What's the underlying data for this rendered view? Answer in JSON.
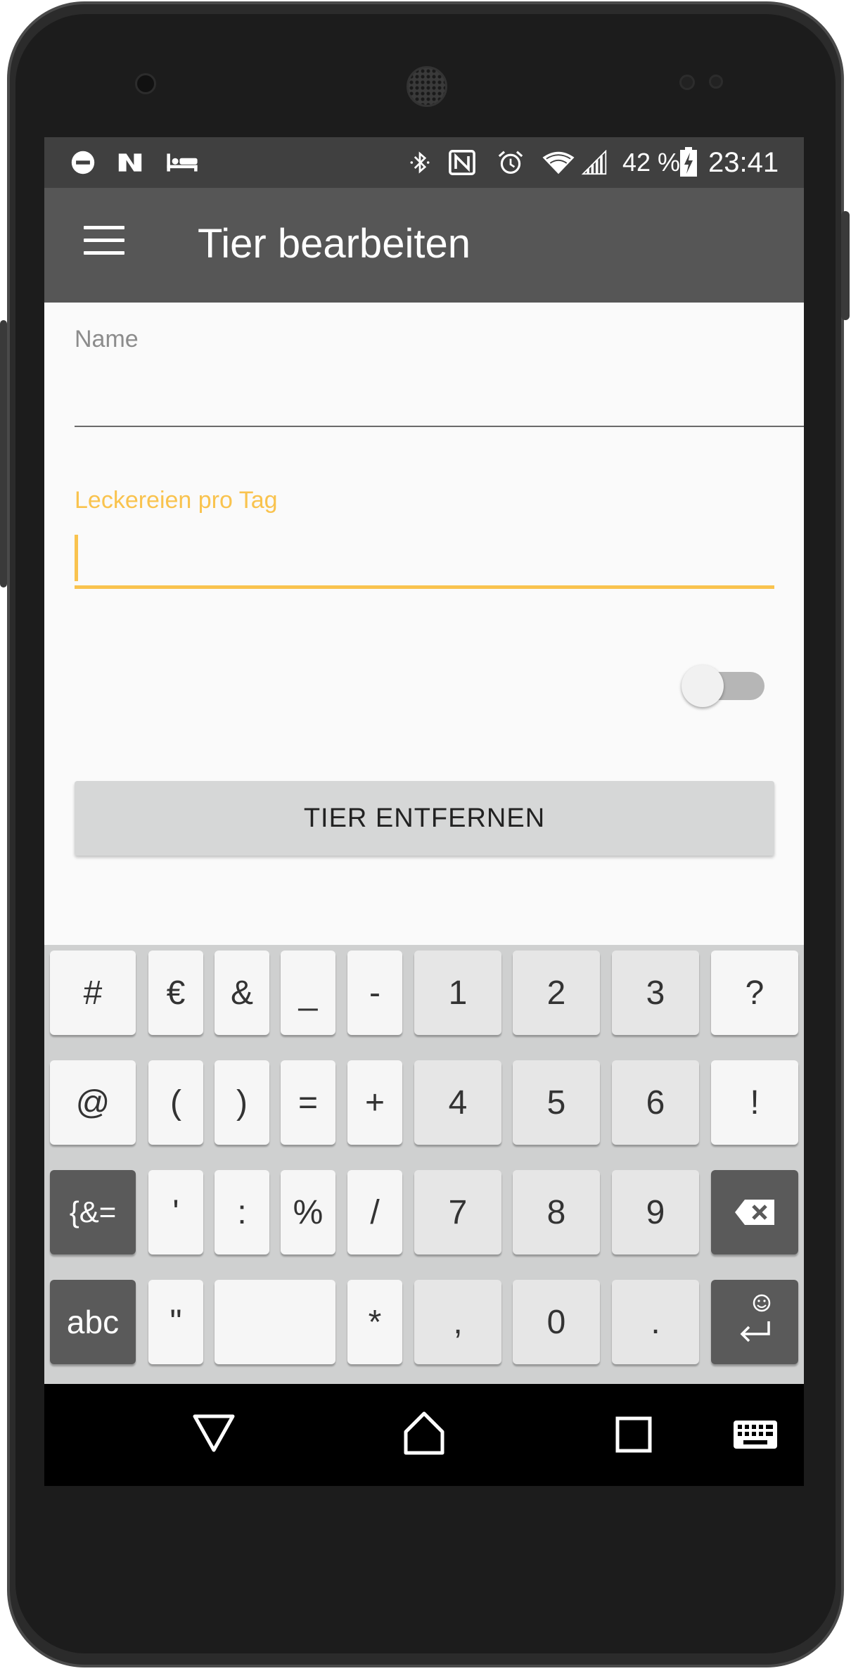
{
  "status_bar": {
    "battery_percent": "42 %",
    "time": "23:41",
    "left_icons": [
      "do-not-disturb-icon",
      "n-app-icon",
      "sleep-bed-icon"
    ],
    "right_icons": [
      "bluetooth-icon",
      "nfc-icon",
      "alarm-icon",
      "wifi-icon",
      "cell-signal-icon",
      "battery-charging-icon"
    ]
  },
  "app_bar": {
    "title": "Tier bearbeiten",
    "menu_icon": "hamburger-menu-icon"
  },
  "form": {
    "name_label": "Name",
    "name_value": "",
    "treats_label": "Leckereien pro Tag",
    "treats_value": "",
    "switch_on": false,
    "remove_button": "TIER ENTFERNEN"
  },
  "keyboard": {
    "rows": [
      [
        "#",
        "€",
        "&",
        "_",
        "-",
        "1",
        "2",
        "3",
        "?"
      ],
      [
        "@",
        "(",
        ")",
        "=",
        "+",
        "4",
        "5",
        "6",
        "!"
      ],
      [
        "{&=",
        "'",
        ":",
        "%",
        "/",
        "7",
        "8",
        "9",
        "backspace"
      ],
      [
        "abc",
        "\"",
        "space",
        "*",
        ",",
        "0",
        ".",
        "enter"
      ]
    ]
  },
  "nav_bar": {
    "icons": [
      "back-triangle-icon",
      "home-icon",
      "recents-square-icon",
      "keyboard-icon"
    ]
  },
  "colors": {
    "app_bar": "#565656",
    "status_bar": "#404040",
    "accent": "#f9c34e",
    "background": "#fafafa",
    "button": "#d6d7d7"
  }
}
